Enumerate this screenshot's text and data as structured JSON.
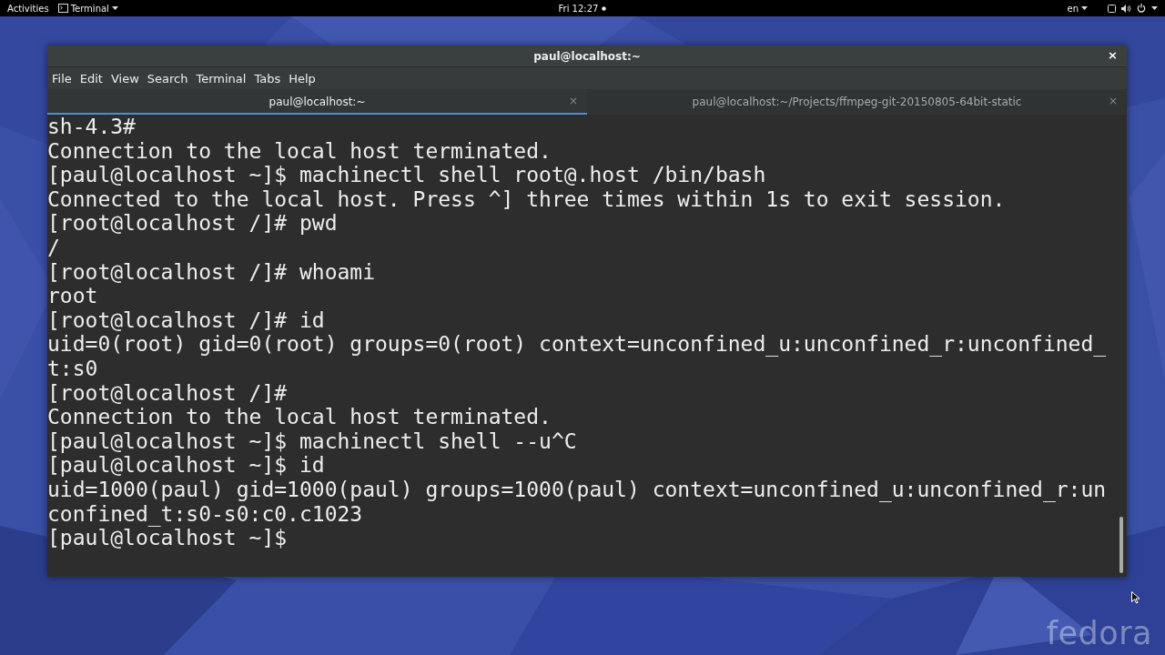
{
  "top_bar": {
    "activities": "Activities",
    "app_menu": "Terminal",
    "clock": "Fri 12:27",
    "language": "en"
  },
  "window": {
    "title": "paul@localhost:~",
    "close": "×"
  },
  "menu": [
    "File",
    "Edit",
    "View",
    "Search",
    "Terminal",
    "Tabs",
    "Help"
  ],
  "tabs": [
    {
      "label": "paul@localhost:~",
      "selected": true,
      "close": "×"
    },
    {
      "label": "paul@localhost:~/Projects/ffmpeg-git-20150805-64bit-static",
      "selected": false,
      "close": "×"
    }
  ],
  "terminal_lines": [
    "sh-4.3#",
    "Connection to the local host terminated.",
    "[paul@localhost ~]$ machinectl shell root@.host /bin/bash",
    "Connected to the local host. Press ^] three times within 1s to exit session.",
    "[root@localhost /]# pwd",
    "/",
    "[root@localhost /]# whoami",
    "root",
    "[root@localhost /]# id",
    "uid=0(root) gid=0(root) groups=0(root) context=unconfined_u:unconfined_r:unconfined_",
    "t:s0",
    "[root@localhost /]#",
    "Connection to the local host terminated.",
    "[paul@localhost ~]$ machinectl shell --u^C",
    "[paul@localhost ~]$ id",
    "uid=1000(paul) gid=1000(paul) groups=1000(paul) context=unconfined_u:unconfined_r:un",
    "confined_t:s0-s0:c0.c1023",
    "[paul@localhost ~]$"
  ],
  "wallpaper_logo": "fedora"
}
